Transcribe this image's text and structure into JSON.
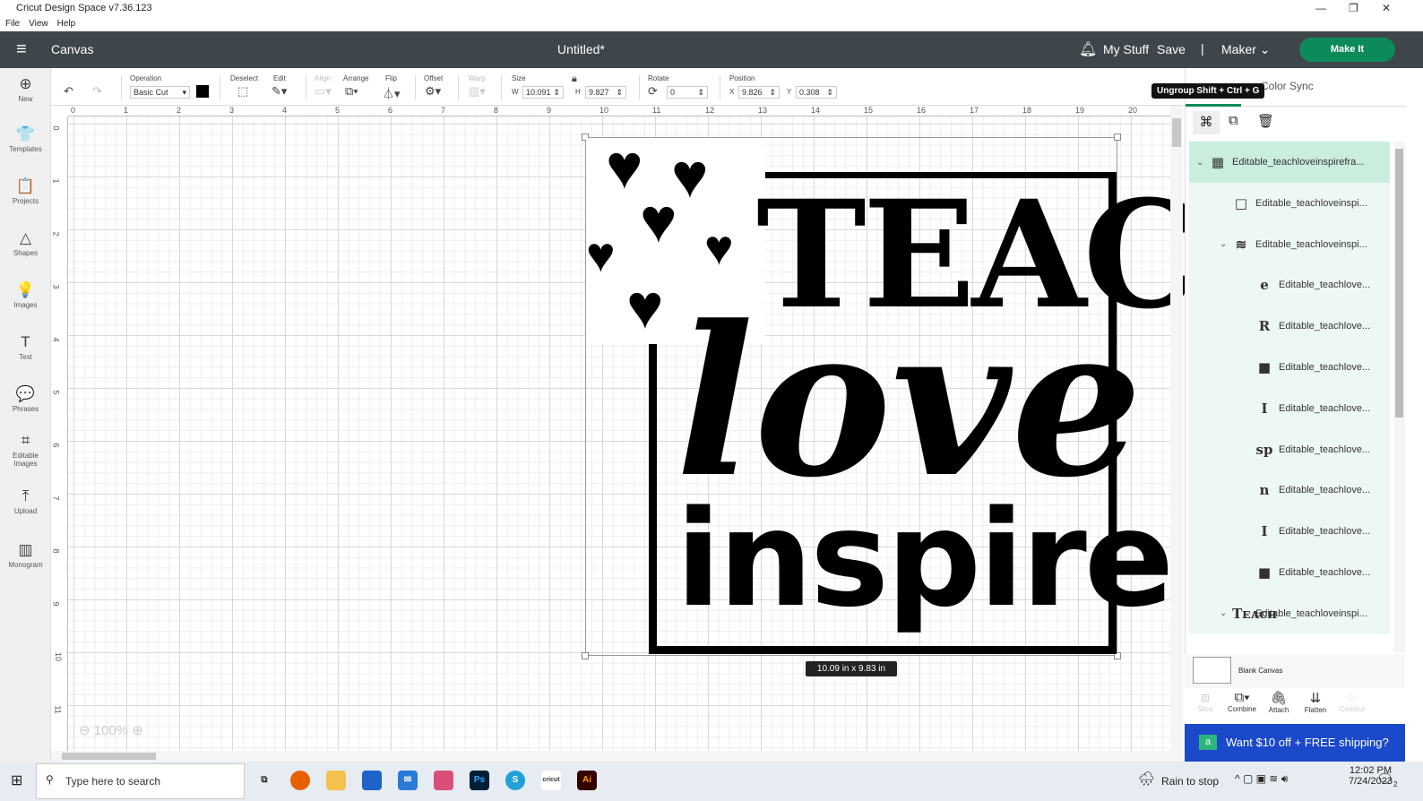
{
  "window": {
    "title": "Cricut Design Space  v7.36.123",
    "menu": [
      "File",
      "View",
      "Help"
    ]
  },
  "header": {
    "section": "Canvas",
    "doc_title": "Untitled*",
    "my_stuff": "My Stuff",
    "save": "Save",
    "sep": "|",
    "machine": "Maker",
    "make_it": "Make It"
  },
  "sidebar": [
    {
      "label": "New",
      "icon": "⊕"
    },
    {
      "label": "Templates",
      "icon": "👕"
    },
    {
      "label": "Projects",
      "icon": "📋"
    },
    {
      "label": "Shapes",
      "icon": "△"
    },
    {
      "label": "Images",
      "icon": "💡"
    },
    {
      "label": "Text",
      "icon": "T"
    },
    {
      "label": "Phrases",
      "icon": "💬"
    },
    {
      "label": "Editable Images",
      "icon": "⌗"
    },
    {
      "label": "Upload",
      "icon": "⤒"
    },
    {
      "label": "Monogram",
      "icon": "▥"
    }
  ],
  "toolbar": {
    "operation_label": "Operation",
    "operation_value": "Basic Cut",
    "deselect": "Deselect",
    "edit": "Edit",
    "align": "Align",
    "arrange": "Arrange",
    "flip": "Flip",
    "offset": "Offset",
    "warp": "Warp",
    "size": "Size",
    "w_label": "W",
    "w": "10.091",
    "h_label": "H",
    "h": "9.827",
    "rotate": "Rotate",
    "rotate_value": "0",
    "position": "Position",
    "x_label": "X",
    "x": "9.826",
    "y_label": "Y",
    "y": "0.308"
  },
  "ruler": {
    "top": [
      "0",
      "1",
      "2",
      "3",
      "4",
      "5",
      "6",
      "7",
      "8",
      "9",
      "10",
      "11",
      "12",
      "13",
      "14",
      "15",
      "16",
      "17",
      "18",
      "19",
      "20"
    ],
    "left": [
      "0",
      "1",
      "2",
      "3",
      "4",
      "5",
      "6",
      "7",
      "8",
      "9",
      "10",
      "11"
    ]
  },
  "design": {
    "words": [
      "TEACH",
      "love",
      "inspire"
    ],
    "size_badge": "10.09  in x 9.83  in"
  },
  "zoom": {
    "value": "100%"
  },
  "panel": {
    "tab": "Color Sync",
    "tooltip": "Ungroup Shift + Ctrl + G",
    "layers": [
      {
        "name": "Editable_teachloveinspirefra...",
        "thumb": "▦",
        "chev": "⌄",
        "indent": 0,
        "selected": true
      },
      {
        "name": "Editable_teachloveinspi...",
        "thumb": "□",
        "chev": "",
        "indent": 1
      },
      {
        "name": "Editable_teachloveinspi...",
        "thumb": "≋",
        "chev": "⌄",
        "indent": 1
      },
      {
        "name": "Editable_teachlove...",
        "thumb": "e",
        "chev": "",
        "indent": 2
      },
      {
        "name": "Editable_teachlove...",
        "thumb": "R",
        "chev": "",
        "indent": 2
      },
      {
        "name": "Editable_teachlove...",
        "thumb": "■",
        "chev": "",
        "indent": 2
      },
      {
        "name": "Editable_teachlove...",
        "thumb": "I",
        "chev": "",
        "indent": 2
      },
      {
        "name": "Editable_teachlove...",
        "thumb": "sp",
        "chev": "",
        "indent": 2
      },
      {
        "name": "Editable_teachlove...",
        "thumb": "n",
        "chev": "",
        "indent": 2
      },
      {
        "name": "Editable_teachlove...",
        "thumb": "I",
        "chev": "",
        "indent": 2
      },
      {
        "name": "Editable_teachlove...",
        "thumb": "■",
        "chev": "",
        "indent": 2
      },
      {
        "name": "Editable_teachloveinspi...",
        "thumb": "Tᴇᴀᴄʜ",
        "chev": "⌄",
        "indent": 1
      }
    ],
    "blank_canvas": "Blank Canvas",
    "tools": [
      "Slice",
      "Combine",
      "Attach",
      "Flatten",
      "Contour"
    ],
    "promo": "Want $10 off + FREE shipping?"
  },
  "taskbar": {
    "search": "Type here to search",
    "weather": "Rain to stop",
    "time": "12:02 PM",
    "date": "7/24/2023",
    "notif": "2"
  }
}
